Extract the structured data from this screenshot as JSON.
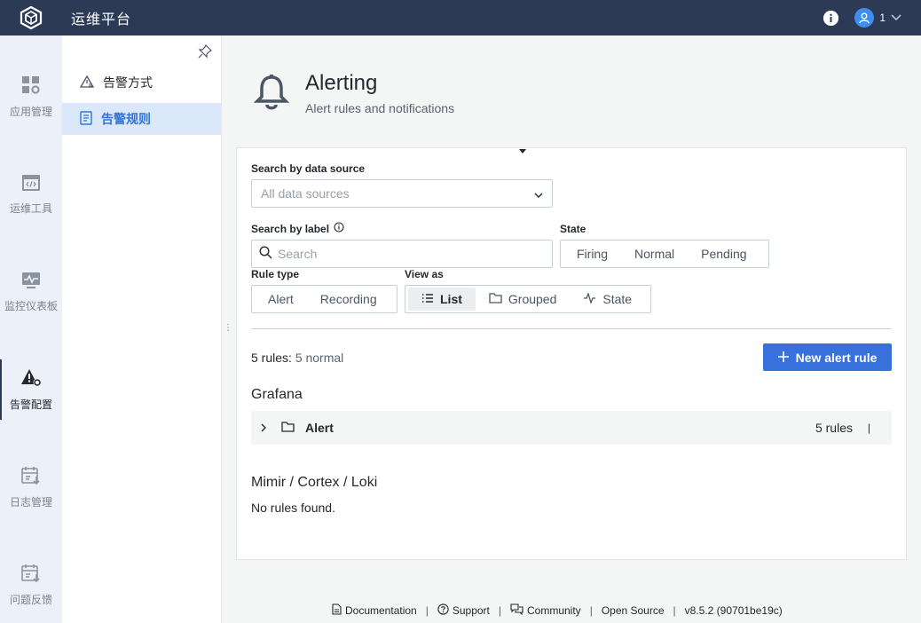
{
  "topbar": {
    "title": "运维平台",
    "user_label": "1",
    "icons": {
      "logo": "cube-logo-icon",
      "info": "info-icon",
      "user": "user-avatar-icon",
      "dropdown": "chevron-down-icon"
    }
  },
  "rail": {
    "items": [
      {
        "label": "应用管理",
        "icon": "apps-grid-icon"
      },
      {
        "label": "运维工具",
        "icon": "code-window-icon"
      },
      {
        "label": "监控仪表板",
        "icon": "monitor-pulse-icon"
      },
      {
        "label": "告警配置",
        "icon": "alert-gear-icon",
        "active": true
      },
      {
        "label": "日志管理",
        "icon": "calendar-download-icon"
      },
      {
        "label": "问题反馈",
        "icon": "calendar-feedback-icon"
      }
    ]
  },
  "submenu": {
    "items": [
      {
        "label": "告警方式",
        "icon": "alert-triangle-icon"
      },
      {
        "label": "告警规则",
        "icon": "rules-list-icon",
        "active": true
      }
    ]
  },
  "header": {
    "title": "Alerting",
    "subtitle": "Alert rules and notifications"
  },
  "filters": {
    "datasource_label": "Search by data source",
    "datasource_placeholder": "All data sources",
    "label_label": "Search by label",
    "search_placeholder": "Search",
    "state_label": "State",
    "state_options": [
      "Firing",
      "Normal",
      "Pending"
    ],
    "rule_type_label": "Rule type",
    "rule_type_options": [
      "Alert",
      "Recording"
    ],
    "view_as_label": "View as",
    "view_as_options": [
      "List",
      "Grouped",
      "State"
    ],
    "view_as_selected": "List"
  },
  "summary": {
    "count_text": "5 rules:",
    "status_text": "5 normal"
  },
  "new_button": "New alert rule",
  "grafana": {
    "heading": "Grafana",
    "folder_name": "Alert",
    "folder_count": "5 rules",
    "pipe": "|"
  },
  "external": {
    "heading": "Mimir / Cortex / Loki",
    "empty_text": "No rules found."
  },
  "footer": {
    "links": [
      "Documentation",
      "Support",
      "Community",
      "Open Source"
    ],
    "version": "v8.5.2 (90701be19c)",
    "sep": "|"
  },
  "colors": {
    "topbar": "#2c3a55",
    "primary": "#3871dc",
    "active_submenu_bg": "#dbe8fa",
    "active_submenu_text": "#3274d9"
  }
}
